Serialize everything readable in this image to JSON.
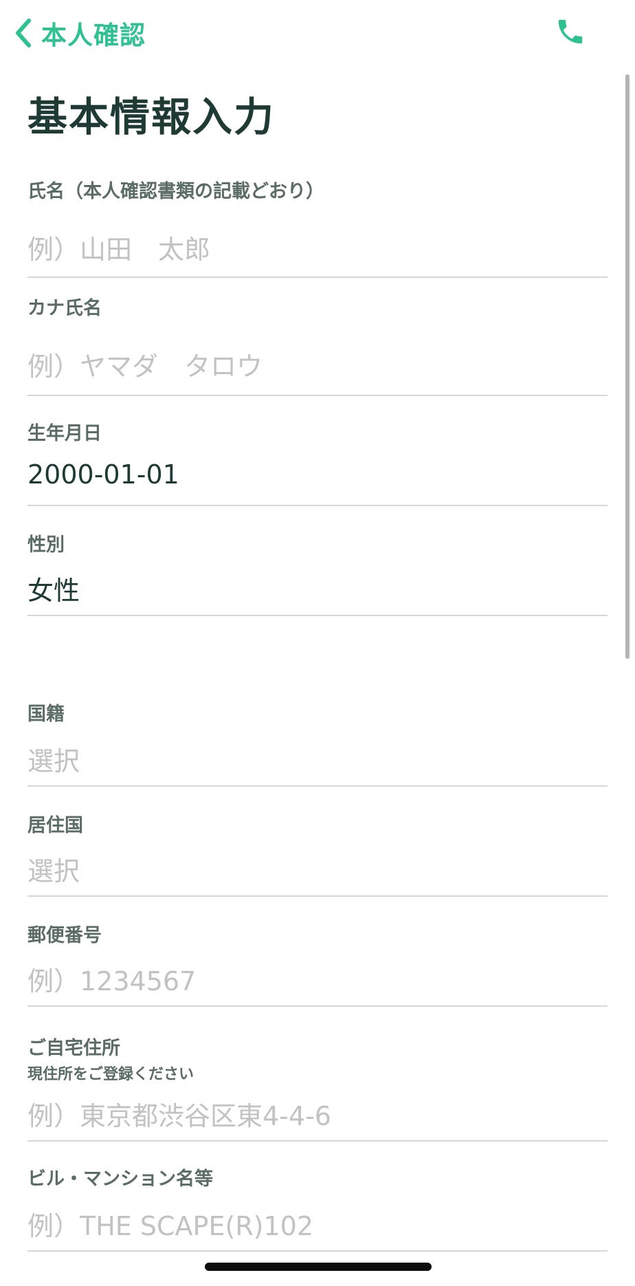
{
  "nav": {
    "back_label": "本人確認",
    "back_icon": "chevron-left-icon",
    "phone_icon": "phone-icon",
    "accent_color": "#2fc18f"
  },
  "page": {
    "title": "基本情報入力"
  },
  "fields": {
    "name": {
      "label": "氏名（本人確認書類の記載どおり）",
      "placeholder": "例）山田　太郎"
    },
    "kana": {
      "label": "カナ氏名",
      "placeholder": "例）ヤマダ　タロウ"
    },
    "birthdate": {
      "label": "生年月日",
      "value": "2000-01-01"
    },
    "gender": {
      "label": "性別",
      "value": "女性"
    },
    "nationality": {
      "label": "国籍",
      "placeholder": "選択"
    },
    "residence_country": {
      "label": "居住国",
      "placeholder": "選択"
    },
    "postal_code": {
      "label": "郵便番号",
      "placeholder": "例）1234567"
    },
    "address": {
      "label": "ご自宅住所",
      "sublabel": "現住所をご登録ください",
      "placeholder": "例）東京都渋谷区東4-4-6"
    },
    "building": {
      "label": "ビル・マンション名等",
      "placeholder": "例）THE SCAPE(R)102"
    }
  }
}
